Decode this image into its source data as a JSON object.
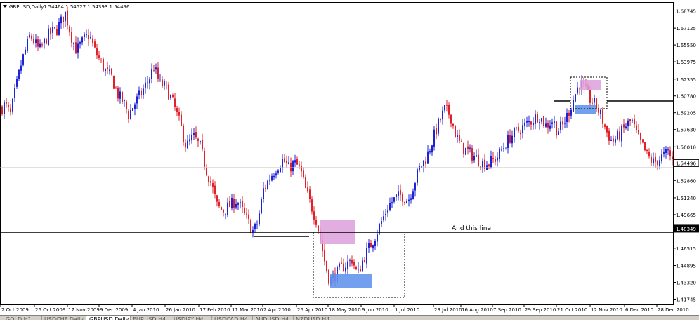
{
  "header": {
    "symbol": "GBPUSD,Daily",
    "quote": "1.54464 1.54527 1.54393 1.54496"
  },
  "annotation_text": "And this line",
  "colors": {
    "bull": "#1e22d6",
    "bear": "#e0212b",
    "pink_zone": "#dda0dd",
    "blue_zone": "#6495ed",
    "line": "#000000",
    "price_line": "#c0c0c0"
  },
  "tabs": [
    "GOLD,H1",
    "USDCHF,Daily",
    "GBPUSD,Daily",
    "EURUSD,H4",
    "USDJPY,H4",
    "USDCAD,H4",
    "AUDUSD,H4",
    "NZDUSD,H4"
  ],
  "active_tab": 2,
  "chart_data": {
    "type": "candlestick",
    "symbol": "GBPUSD",
    "timeframe": "Daily",
    "ylim": [
      1.4125,
      1.695
    ],
    "y_ticks": [
      "1.68745",
      "1.67125",
      "1.65550",
      "1.63975",
      "1.62355",
      "1.60780",
      "1.59205",
      "1.57630",
      "1.56010",
      "1.54496",
      "1.52860",
      "1.51240",
      "1.49665",
      "1.48349",
      "1.46515",
      "1.44895",
      "1.43320",
      "1.41745"
    ],
    "current_price": "1.54496",
    "marked_level": "1.48349",
    "x_ticks": [
      "2 Oct 2009",
      "26 Oct 2009",
      "17 Nov 2009",
      "9 Dec 2009",
      "4 Jan 2010",
      "26 Jan 2010",
      "17 Feb 2010",
      "11 Mar 2010",
      "2 Apr 2010",
      "26 Apr 2010",
      "18 May 2010",
      "9 Jun 2010",
      "1 Jul 2010",
      "23 Jul 2010",
      "16 Aug 2010",
      "7 Sep 2010",
      "29 Sep 2010",
      "21 Oct 2010",
      "12 Nov 2010",
      "6 Dec 2010",
      "28 Dec 2010"
    ],
    "close_path": [
      [
        0,
        1.595
      ],
      [
        6,
        1.6
      ],
      [
        14,
        1.59
      ],
      [
        20,
        1.61
      ],
      [
        30,
        1.64
      ],
      [
        42,
        1.665
      ],
      [
        55,
        1.65
      ],
      [
        68,
        1.665
      ],
      [
        80,
        1.67
      ],
      [
        92,
        1.685
      ],
      [
        100,
        1.665
      ],
      [
        108,
        1.65
      ],
      [
        118,
        1.66
      ],
      [
        126,
        1.665
      ],
      [
        134,
        1.65
      ],
      [
        142,
        1.64
      ],
      [
        150,
        1.63
      ],
      [
        158,
        1.625
      ],
      [
        166,
        1.61
      ],
      [
        176,
        1.6
      ],
      [
        182,
        1.59
      ],
      [
        190,
        1.6
      ],
      [
        200,
        1.61
      ],
      [
        212,
        1.625
      ],
      [
        218,
        1.635
      ],
      [
        226,
        1.62
      ],
      [
        236,
        1.615
      ],
      [
        246,
        1.6
      ],
      [
        256,
        1.58
      ],
      [
        264,
        1.56
      ],
      [
        274,
        1.57
      ],
      [
        284,
        1.56
      ],
      [
        292,
        1.54
      ],
      [
        300,
        1.525
      ],
      [
        308,
        1.505
      ],
      [
        316,
        1.5
      ],
      [
        326,
        1.505
      ],
      [
        336,
        1.51
      ],
      [
        348,
        1.495
      ],
      [
        360,
        1.48
      ],
      [
        366,
        1.49
      ],
      [
        374,
        1.52
      ],
      [
        382,
        1.53
      ],
      [
        392,
        1.54
      ],
      [
        402,
        1.548
      ],
      [
        410,
        1.54
      ],
      [
        418,
        1.545
      ],
      [
        426,
        1.54
      ],
      [
        434,
        1.52
      ],
      [
        442,
        1.505
      ],
      [
        450,
        1.49
      ],
      [
        456,
        1.47
      ],
      [
        462,
        1.45
      ],
      [
        468,
        1.435
      ],
      [
        474,
        1.438
      ],
      [
        482,
        1.445
      ],
      [
        492,
        1.45
      ],
      [
        500,
        1.455
      ],
      [
        508,
        1.44
      ],
      [
        516,
        1.455
      ],
      [
        524,
        1.465
      ],
      [
        534,
        1.478
      ],
      [
        542,
        1.49
      ],
      [
        552,
        1.505
      ],
      [
        562,
        1.512
      ],
      [
        570,
        1.515
      ],
      [
        580,
        1.51
      ],
      [
        588,
        1.525
      ],
      [
        596,
        1.54
      ],
      [
        606,
        1.55
      ],
      [
        614,
        1.565
      ],
      [
        622,
        1.58
      ],
      [
        632,
        1.595
      ],
      [
        640,
        1.59
      ],
      [
        648,
        1.57
      ],
      [
        656,
        1.56
      ],
      [
        666,
        1.555
      ],
      [
        676,
        1.55
      ],
      [
        686,
        1.545
      ],
      [
        696,
        1.545
      ],
      [
        706,
        1.55
      ],
      [
        716,
        1.56
      ],
      [
        726,
        1.57
      ],
      [
        736,
        1.575
      ],
      [
        746,
        1.58
      ],
      [
        756,
        1.585
      ],
      [
        766,
        1.59
      ],
      [
        776,
        1.58
      ],
      [
        786,
        1.585
      ],
      [
        792,
        1.575
      ],
      [
        800,
        1.58
      ],
      [
        810,
        1.595
      ],
      [
        818,
        1.61
      ],
      [
        824,
        1.62
      ],
      [
        830,
        1.615
      ],
      [
        838,
        1.605
      ],
      [
        846,
        1.6
      ],
      [
        854,
        1.59
      ],
      [
        862,
        1.575
      ],
      [
        870,
        1.565
      ],
      [
        880,
        1.57
      ],
      [
        890,
        1.58
      ],
      [
        898,
        1.585
      ],
      [
        906,
        1.57
      ],
      [
        914,
        1.56
      ],
      [
        922,
        1.55
      ],
      [
        930,
        1.545
      ],
      [
        940,
        1.55
      ],
      [
        950,
        1.555
      ],
      [
        958,
        1.545
      ]
    ]
  }
}
